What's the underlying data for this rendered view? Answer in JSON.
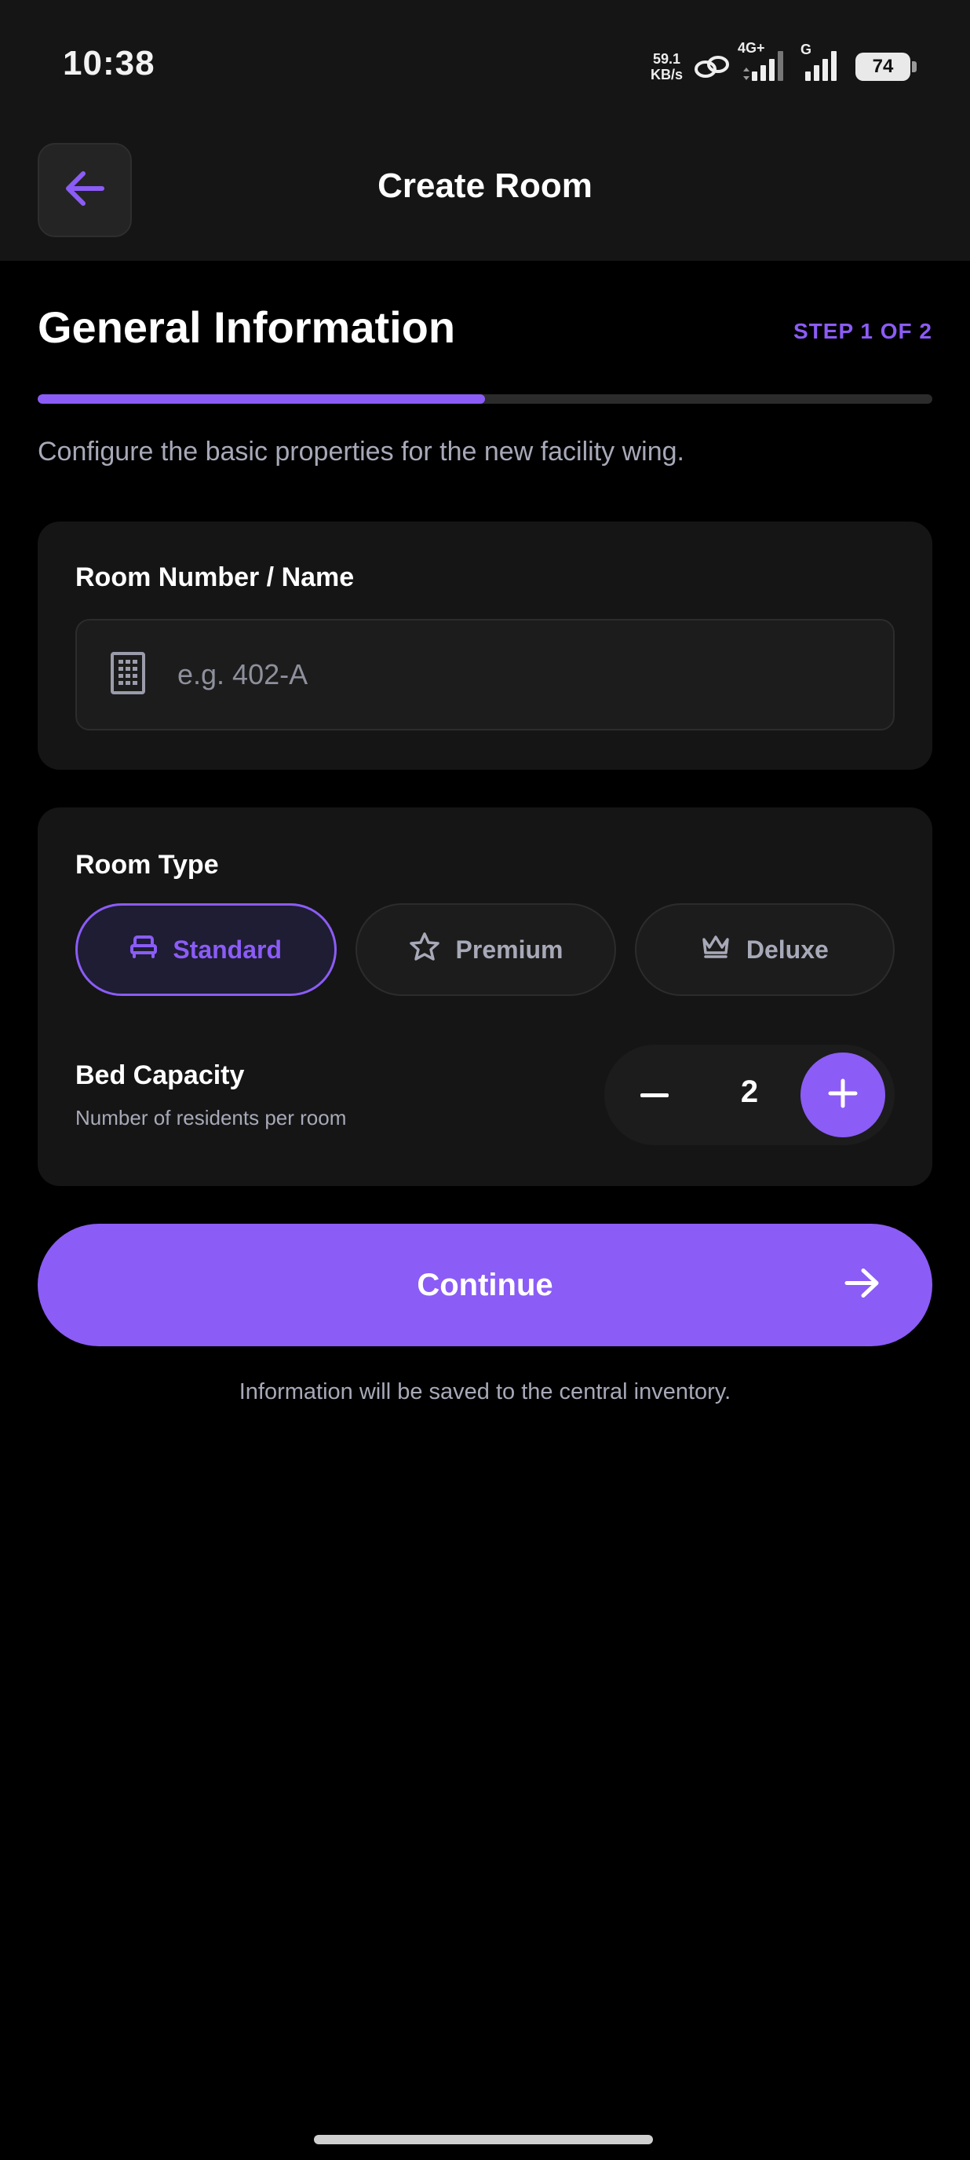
{
  "status_bar": {
    "time": "10:38",
    "net_speed_value": "59.1",
    "net_speed_unit": "KB/s",
    "network_type": "4G+",
    "sim2_tag": "G",
    "battery": "74"
  },
  "header": {
    "title": "Create Room",
    "back_icon": "arrow-left-icon"
  },
  "section": {
    "title": "General Information",
    "step": "STEP 1 OF 2",
    "progress_fraction": 0.5,
    "subtitle": "Configure the basic properties for the new facility wing."
  },
  "room_name": {
    "label": "Room Number / Name",
    "placeholder": "e.g. 402-A",
    "value": "",
    "icon": "building-icon"
  },
  "room_type": {
    "label": "Room Type",
    "selected": "Standard",
    "options": [
      {
        "label": "Standard",
        "icon": "bed-icon"
      },
      {
        "label": "Premium",
        "icon": "star-icon"
      },
      {
        "label": "Deluxe",
        "icon": "crown-icon"
      }
    ]
  },
  "bed_capacity": {
    "label": "Bed Capacity",
    "hint": "Number of residents per room",
    "value": "2"
  },
  "actions": {
    "continue_label": "Continue",
    "footnote": "Information will be saved to the central inventory."
  },
  "colors": {
    "accent": "#8b5cf6",
    "background": "#000000",
    "surface": "#151515",
    "muted_text": "#a7a9b8"
  }
}
